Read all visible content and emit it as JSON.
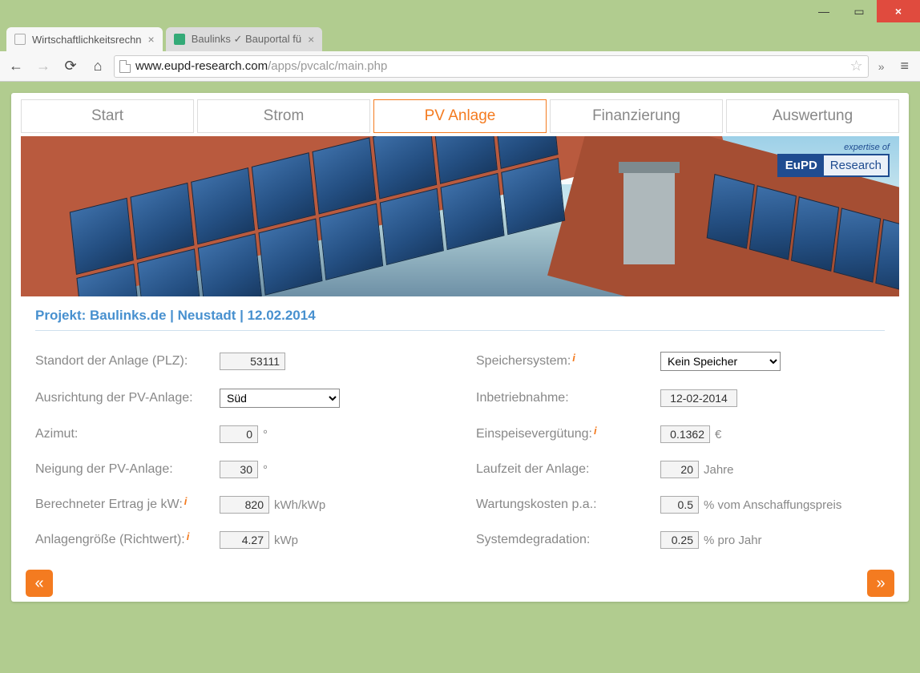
{
  "window": {
    "tabs": [
      {
        "title": "Wirtschaftlichkeitsrechn",
        "close": "×"
      },
      {
        "title": "Baulinks ✓ Bauportal fü",
        "close": "×"
      }
    ]
  },
  "address": {
    "host": "www.eupd-research.com",
    "path": "/apps/pvcalc/main.php"
  },
  "nav_tabs": [
    "Start",
    "Strom",
    "PV Anlage",
    "Finanzierung",
    "Auswertung"
  ],
  "brand": {
    "expertise": "expertise of",
    "left": "EuPD",
    "right": "Research"
  },
  "project": "Projekt: Baulinks.de | Neustadt | 12.02.2014",
  "left_col": [
    {
      "label": "Standort der Anlage (PLZ):",
      "value": "53111",
      "type": "text",
      "w": "w80",
      "unit": ""
    },
    {
      "label": "Ausrichtung der PV-Anlage:",
      "value": "Süd",
      "type": "select",
      "w": "w130"
    },
    {
      "label": "Azimut:",
      "value": "0",
      "type": "text",
      "w": "w50",
      "unit": "°"
    },
    {
      "label": "Neigung der PV-Anlage:",
      "value": "30",
      "type": "text",
      "w": "w50",
      "unit": "°"
    },
    {
      "label": "Berechneter Ertrag je kW:",
      "info": true,
      "value": "820",
      "type": "text",
      "w": "w60",
      "unit": "kWh/kWp"
    },
    {
      "label": "Anlagengröße (Richtwert):",
      "info": true,
      "value": "4.27",
      "type": "text",
      "w": "w60",
      "unit": "kWp"
    }
  ],
  "right_col": [
    {
      "label": "Speichersystem:",
      "info": true,
      "value": "Kein Speicher",
      "type": "select",
      "w": "w130"
    },
    {
      "label": "Inbetriebnahme:",
      "value": "12-02-2014",
      "type": "text",
      "w": "w100",
      "unit": ""
    },
    {
      "label": "Einspeisevergütung:",
      "info": true,
      "value": "0.1362",
      "type": "text",
      "w": "w60",
      "unit": "€"
    },
    {
      "label": "Laufzeit der Anlage:",
      "value": "20",
      "type": "text",
      "w": "w50",
      "unit": "Jahre"
    },
    {
      "label": "Wartungskosten p.a.:",
      "value": "0.5",
      "type": "text",
      "w": "w50",
      "unit": "% vom Anschaffungspreis"
    },
    {
      "label": "Systemdegradation:",
      "value": "0.25",
      "type": "text",
      "w": "w50",
      "unit": "% pro Jahr"
    }
  ],
  "nav_btn": {
    "prev": "«",
    "next": "»"
  }
}
